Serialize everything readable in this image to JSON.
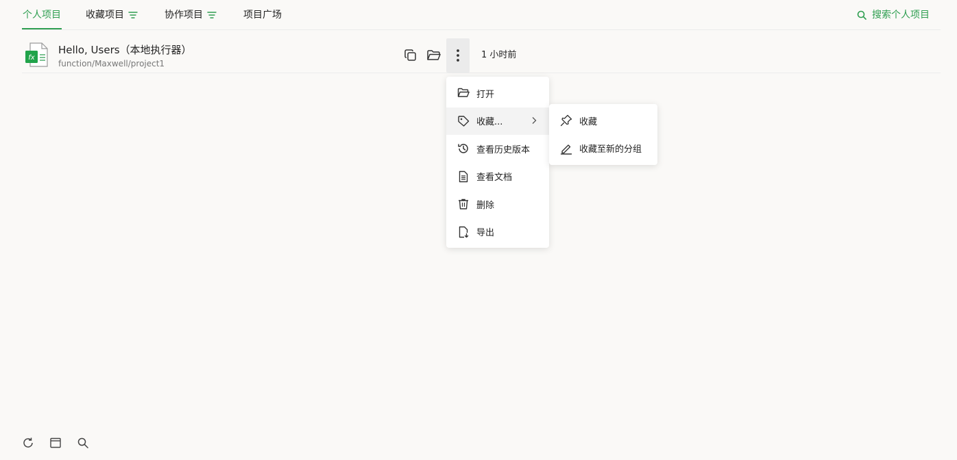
{
  "tabs": [
    {
      "label": "个人项目",
      "active": true,
      "has_filter": false
    },
    {
      "label": "收藏项目",
      "active": false,
      "has_filter": true
    },
    {
      "label": "协作项目",
      "active": false,
      "has_filter": true
    },
    {
      "label": "项目广场",
      "active": false,
      "has_filter": false
    }
  ],
  "search": {
    "label": "搜索个人项目"
  },
  "project": {
    "title": "Hello, Users（本地执行器）",
    "path": "function/Maxwell/project1",
    "time": "1 小时前"
  },
  "menu": {
    "items": [
      {
        "label": "打开",
        "icon": "folder-open-icon"
      },
      {
        "label": "收藏...",
        "icon": "tag-icon",
        "has_submenu": true
      },
      {
        "label": "查看历史版本",
        "icon": "history-icon"
      },
      {
        "label": "查看文档",
        "icon": "document-icon"
      },
      {
        "label": "删除",
        "icon": "trash-icon"
      },
      {
        "label": "导出",
        "icon": "export-icon"
      }
    ]
  },
  "submenu": {
    "items": [
      {
        "label": "收藏",
        "icon": "pin-icon"
      },
      {
        "label": "收藏至新的分组",
        "icon": "pencil-icon"
      }
    ]
  },
  "colors": {
    "accent": "#2e9e50",
    "background": "#faf9f7"
  }
}
